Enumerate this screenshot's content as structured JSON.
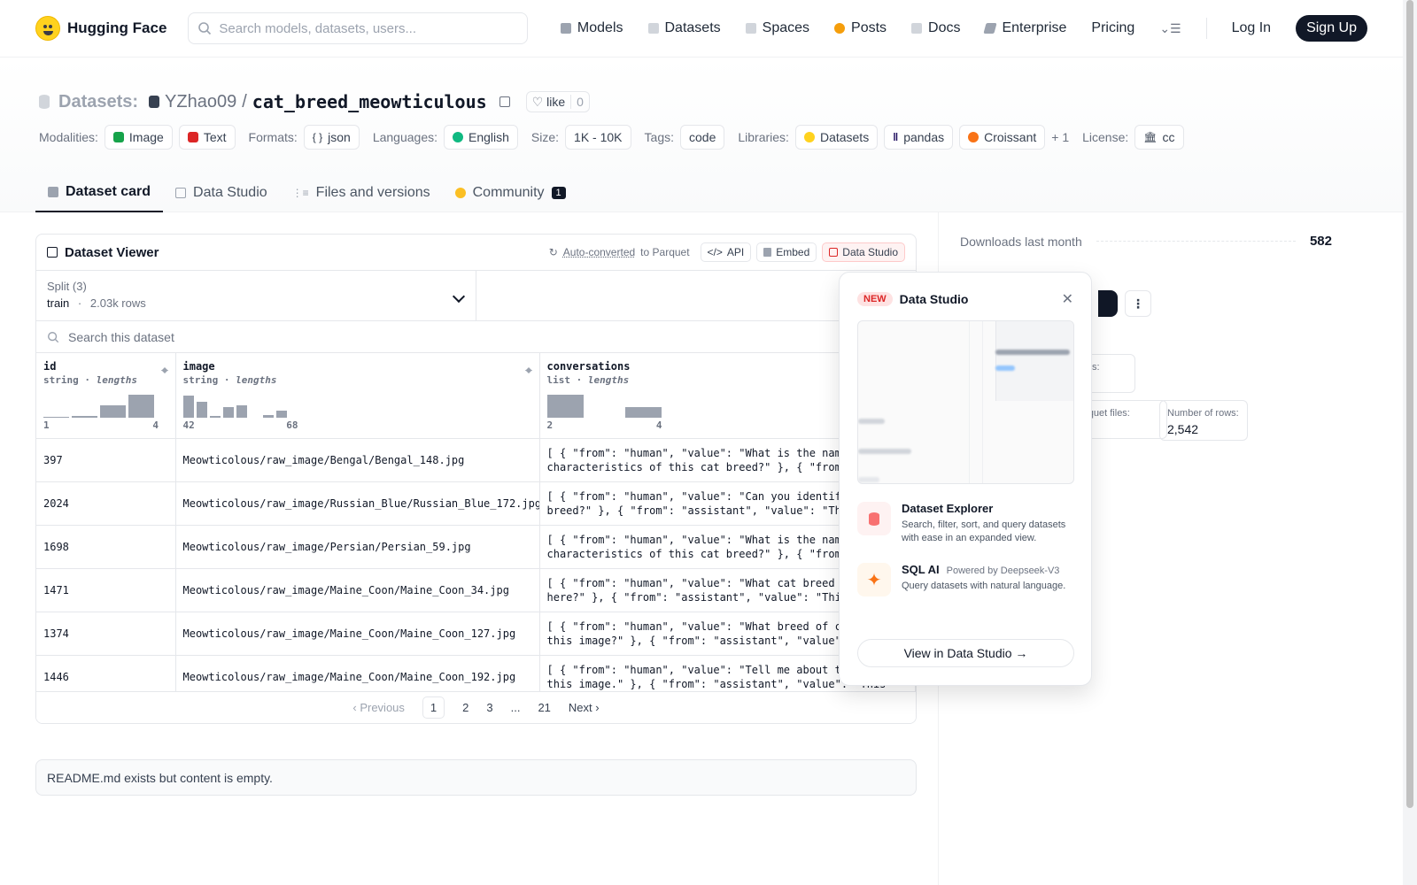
{
  "header": {
    "brand": "Hugging Face",
    "search_placeholder": "Search models, datasets, users...",
    "nav": [
      {
        "label": "Models",
        "color": "#9ca3af"
      },
      {
        "label": "Datasets",
        "color": "#9ca3af"
      },
      {
        "label": "Spaces",
        "color": "#9ca3af"
      },
      {
        "label": "Posts",
        "color": "#f59e0b"
      },
      {
        "label": "Docs",
        "color": "#9ca3af"
      },
      {
        "label": "Enterprise",
        "color": "#6b7280"
      },
      {
        "label": "Pricing"
      }
    ],
    "login": "Log In",
    "signup": "Sign Up"
  },
  "repo": {
    "prefix": "Datasets:",
    "owner": "YZhao09",
    "slash": "/",
    "name": "cat_breed_meowticulous",
    "like_label": "like",
    "like_count": "0"
  },
  "tags": {
    "modalities_label": "Modalities:",
    "modalities": [
      "Image",
      "Text"
    ],
    "formats_label": "Formats:",
    "formats": [
      "json"
    ],
    "languages_label": "Languages:",
    "languages": [
      "English"
    ],
    "size_label": "Size:",
    "size": "1K - 10K",
    "tags_label": "Tags:",
    "tags": [
      "code"
    ],
    "libraries_label": "Libraries:",
    "libraries": [
      "Datasets",
      "pandas",
      "Croissant"
    ],
    "libraries_more": "+ 1",
    "license_label": "License:",
    "license": "cc"
  },
  "tabs": [
    {
      "label": "Dataset card",
      "active": true
    },
    {
      "label": "Data Studio"
    },
    {
      "label": "Files and versions"
    },
    {
      "label": "Community",
      "badge": "1"
    }
  ],
  "viewer": {
    "title": "Dataset Viewer",
    "auto_converted": "Auto-converted",
    "to_parquet": "to Parquet",
    "api": "API",
    "embed": "Embed",
    "data_studio": "Data Studio",
    "split_label": "Split (3)",
    "split_name": "train",
    "split_dot": "·",
    "split_rows": "2.03k rows",
    "search_placeholder": "Search this dataset",
    "columns": [
      {
        "name": "id",
        "type": "string",
        "sub": "lengths",
        "min": "1",
        "max": "4",
        "hist": [
          0.05,
          0.08,
          0.55,
          1.0
        ]
      },
      {
        "name": "image",
        "type": "string",
        "sub": "lengths",
        "min": "42",
        "max": "68",
        "hist": [
          0.95,
          0.7,
          0.06,
          0.45,
          0.55,
          0.0,
          0.12,
          0.3
        ]
      },
      {
        "name": "conversations",
        "type": "list",
        "sub": "lengths",
        "min": "2",
        "max": "4",
        "hist": [
          1.0,
          0.0,
          0.45
        ]
      }
    ],
    "rows": [
      {
        "id": "397",
        "image": "Meowticolous/raw_image/Bengal/Bengal_148.jpg",
        "conv": "[ { \"from\": \"human\", \"value\": \"What is the name and characteristics of this cat breed?\" }, { \"from\": \"assistant\", \"value\": \"This is a Bengal."
      },
      {
        "id": "2024",
        "image": "Meowticolous/raw_image/Russian_Blue/Russian_Blue_172.jpg",
        "conv": "[ { \"from\": \"human\", \"value\": \"Can you identify this cat breed?\" }, { \"from\": \"assistant\", \"value\": \"The cat in the image is"
      },
      {
        "id": "1698",
        "image": "Meowticolous/raw_image/Persian/Persian_59.jpg",
        "conv": "[ { \"from\": \"human\", \"value\": \"What is the name and characteristics of this cat breed?\" }, { \"from\": \"assistant\", \"value\": \"This is a"
      },
      {
        "id": "1471",
        "image": "Meowticolous/raw_image/Maine_Coon/Maine_Coon_34.jpg",
        "conv": "[ { \"from\": \"human\", \"value\": \"What cat breed is shown here?\" }, { \"from\": \"assistant\", \"value\": \"This is a Maine Coon."
      },
      {
        "id": "1374",
        "image": "Meowticolous/raw_image/Maine_Coon/Maine_Coon_127.jpg",
        "conv": "[ { \"from\": \"human\", \"value\": \"What breed of cat is in this image?\" }, { \"from\": \"assistant\", \"value\": \"This is a Maine"
      },
      {
        "id": "1446",
        "image": "Meowticolous/raw_image/Maine_Coon/Maine_Coon_192.jpg",
        "conv": "[ { \"from\": \"human\", \"value\": \"Tell me about the cat in this image.\" }, { \"from\": \"assistant\", \"value\": \"This image"
      }
    ],
    "pager": {
      "prev": "Previous",
      "pages": [
        "1",
        "2",
        "3",
        "...",
        "21"
      ],
      "next": "Next",
      "current": "1"
    }
  },
  "readme": "README.md exists but content is empty.",
  "sidebar": {
    "downloads_label": "Downloads last month",
    "downloads": "582",
    "card1_label": "files:",
    "card2_label": "arquet files:",
    "card3_label": "Number of rows:",
    "card3_value": "2,542"
  },
  "popover": {
    "badge": "NEW",
    "title": "Data Studio",
    "f1_title": "Dataset Explorer",
    "f1_desc": "Search, filter, sort, and query datasets with ease in an expanded view.",
    "f2_title": "SQL AI",
    "f2_powered": "Powered by Deepseek-V3",
    "f2_desc": "Query datasets with natural language.",
    "button": "View in Data Studio →"
  }
}
